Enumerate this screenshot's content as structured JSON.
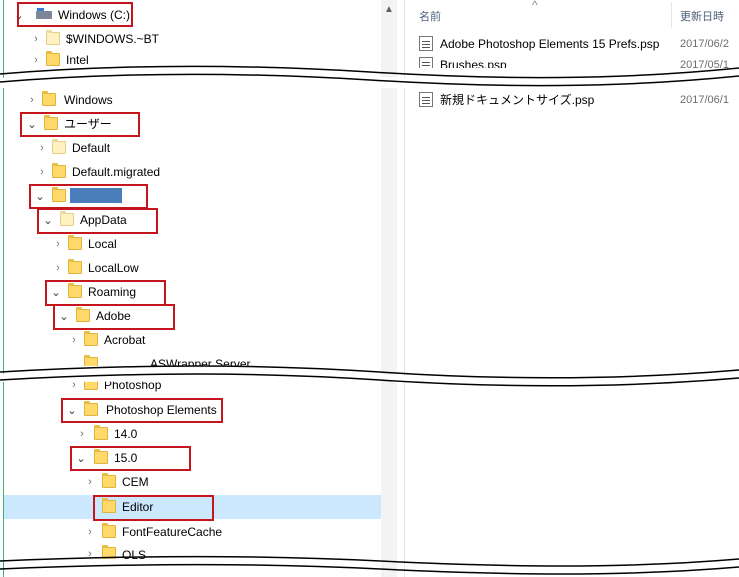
{
  "tree": {
    "drive_label": "Windows (C:)",
    "windows_bt": "$WINDOWS.~BT",
    "intel": "Intel",
    "windows": "Windows",
    "users": "ユーザー",
    "default": "Default",
    "default_migrated": "Default.migrated",
    "appdata": "AppData",
    "local": "Local",
    "locallow": "LocalLow",
    "roaming": "Roaming",
    "adobe": "Adobe",
    "acrobat": "Acrobat",
    "aswrapper": "ASWrapper Server",
    "photoshop": "Photoshop",
    "photoshop_elements": "Photoshop Elements",
    "v14": "14.0",
    "v15": "15.0",
    "cem": "CEM",
    "editor": "Editor",
    "fontfeaturecache": "FontFeatureCache",
    "ols": "OLS"
  },
  "files": {
    "header_name": "名前",
    "header_date": "更新日時",
    "rows": [
      {
        "name": "Adobe Photoshop Elements 15 Prefs.psp",
        "date": "2017/06/2"
      },
      {
        "name": "Brushes.psp",
        "date": "2017/05/1"
      },
      {
        "name": "新規ドキュメントサイズ.psp",
        "date": "2017/06/1"
      }
    ]
  },
  "colors": {
    "highlight_box": "#c4161c",
    "selected_row": "#cce8ff",
    "folder": "#ffd96a"
  },
  "icons": {
    "expand_closed": "›",
    "expand_open": "⌄",
    "scroll_up": "▲",
    "sort_indicator": "^"
  }
}
